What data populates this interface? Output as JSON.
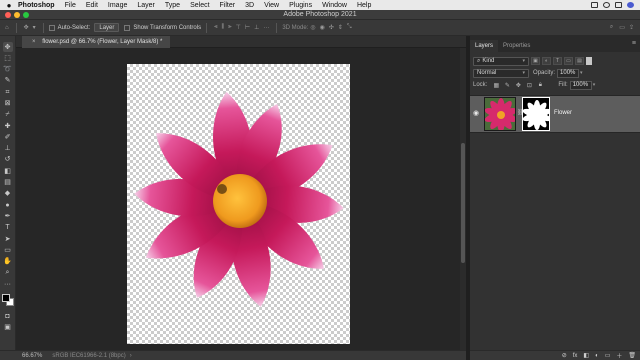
{
  "menubar": {
    "apple": "",
    "app_name": "Photoshop",
    "items": [
      "File",
      "Edit",
      "Image",
      "Layer",
      "Type",
      "Select",
      "Filter",
      "3D",
      "View",
      "Plugins",
      "Window",
      "Help"
    ]
  },
  "window": {
    "title": "Adobe Photoshop 2021"
  },
  "options": {
    "auto_select_label": "Auto-Select:",
    "auto_select_target": "Layer",
    "show_transform_label": "Show Transform Controls",
    "mode_3d_label": "3D Mode:"
  },
  "document": {
    "tab_title": "flower.psd @ 66.7% (Flower, Layer Mask/8) *",
    "close_glyph": "×"
  },
  "status": {
    "zoom": "66.67%",
    "profile": "sRGB IEC61966-2.1 (8bpc)",
    "arrow": "›"
  },
  "panels": {
    "tabs": [
      "Layers",
      "Properties"
    ],
    "menu_glyph": "≡",
    "filter_kind": "Kind",
    "blend_mode": "Normal",
    "opacity_label": "Opacity:",
    "opacity_value": "100%",
    "lock_label": "Lock:",
    "fill_label": "Fill:",
    "fill_value": "100%",
    "layer_name": "Flower",
    "footer_icons": [
      "⊘",
      "fx",
      "◧",
      "◐",
      "▭",
      "＋",
      "🗑"
    ]
  },
  "colors": {
    "flower_petal": "#c5195a",
    "flower_center": "#f0a326",
    "accent_ui": "#323232"
  }
}
